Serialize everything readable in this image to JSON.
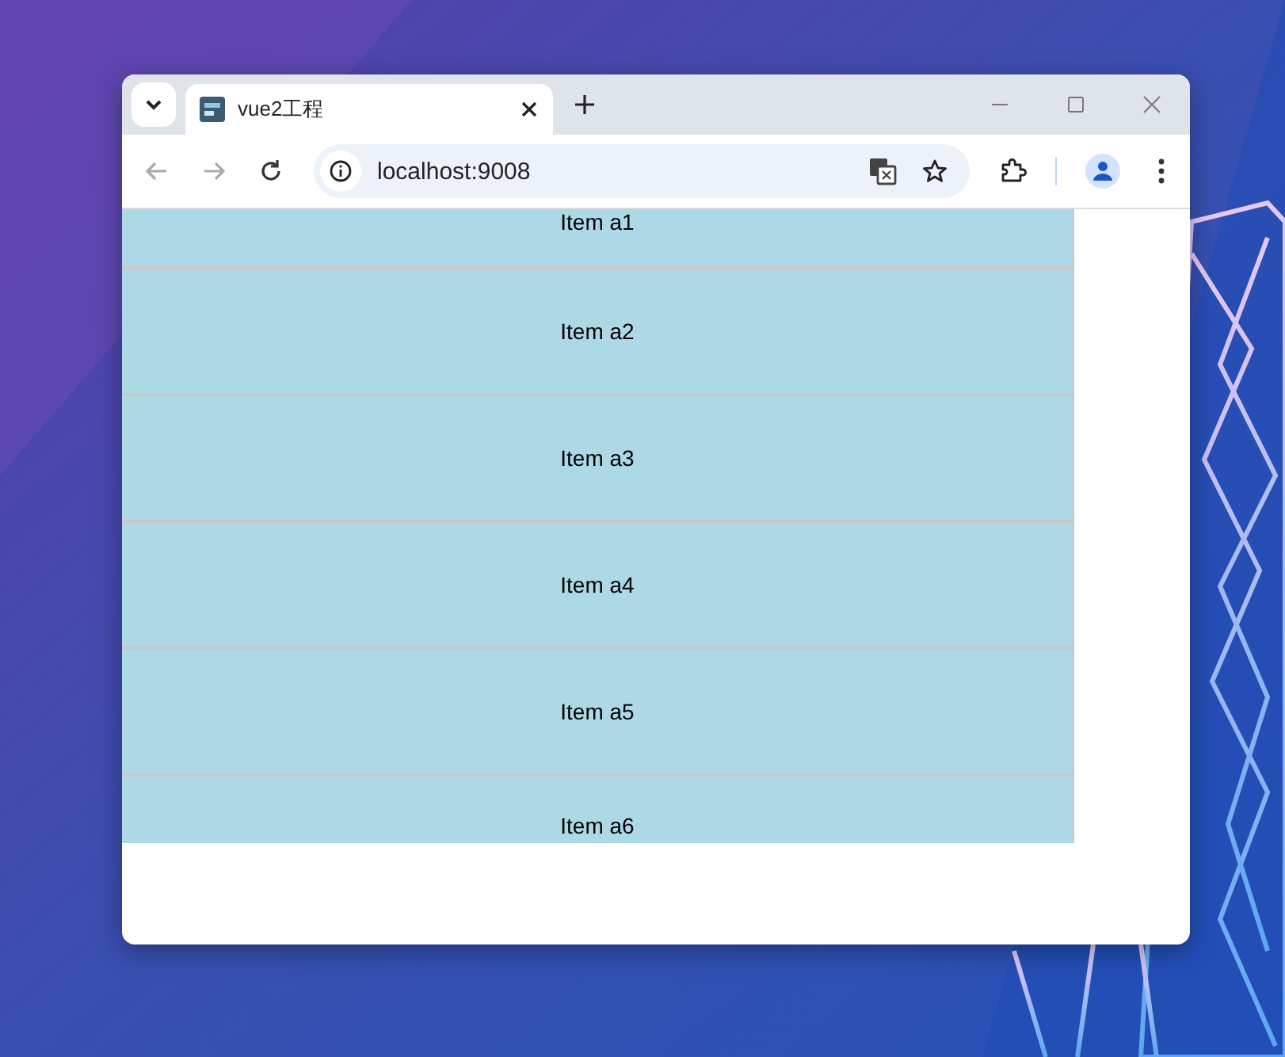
{
  "tabs": [
    {
      "title": "vue2工程",
      "selected": true
    }
  ],
  "nav_buttons": [
    {
      "kind": "back",
      "disabled": true
    },
    {
      "kind": "forward",
      "disabled": true
    },
    {
      "kind": "reload",
      "disabled": false
    }
  ],
  "address_bar": {
    "url": "localhost:9008"
  },
  "list": {
    "items": [
      "Item a1",
      "Item a2",
      "Item a3",
      "Item a4",
      "Item a5",
      "Item a6"
    ]
  }
}
